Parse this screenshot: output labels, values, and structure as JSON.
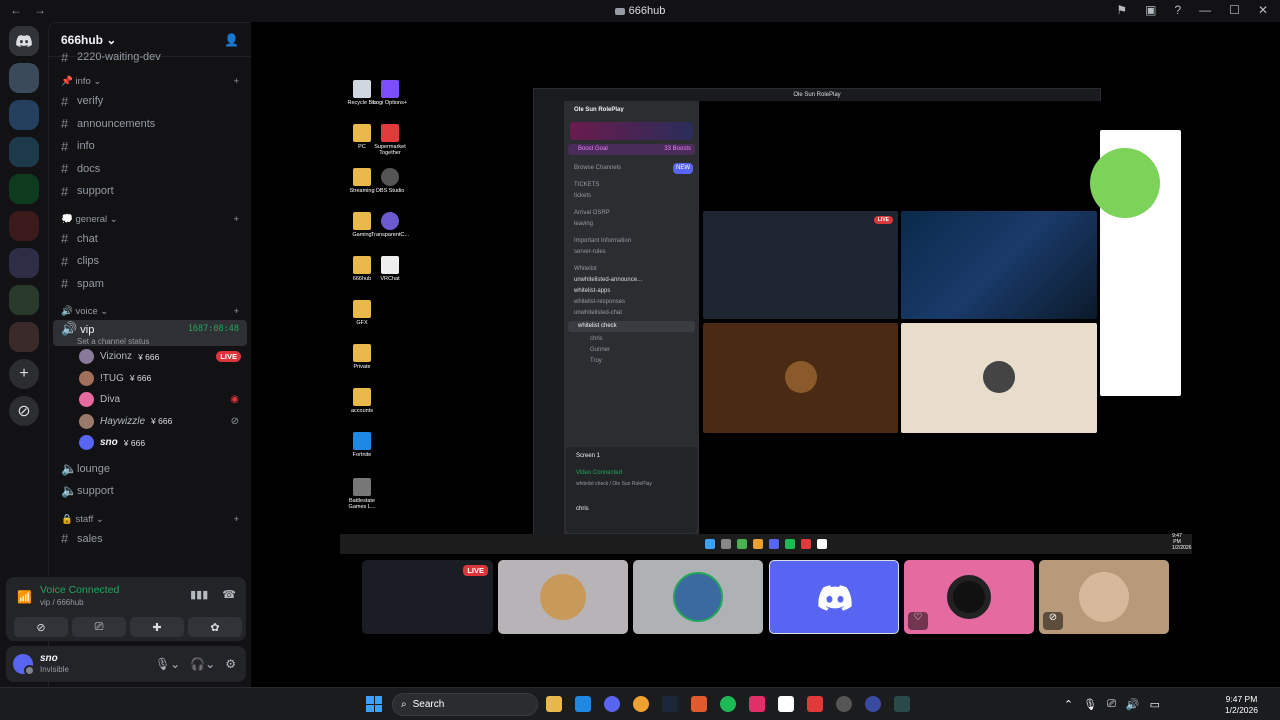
{
  "window": {
    "title": "666hub"
  },
  "server": {
    "name": "666hub"
  },
  "channels": {
    "top_channel": "2220-waiting-dev",
    "cat_info": "info",
    "info_items": [
      "verify",
      "announcements",
      "info",
      "docs",
      "support"
    ],
    "cat_general": "general",
    "general_items": [
      "chat",
      "clips",
      "spam"
    ],
    "cat_voice": "voice",
    "vip": {
      "name": "vip",
      "timer": "1687:08:48",
      "status": "Set a channel status"
    },
    "members": [
      {
        "name": "Vizionz",
        "tag": "666",
        "live": "LIVE"
      },
      {
        "name": "!TUG",
        "tag": "666"
      },
      {
        "name": "Diva"
      },
      {
        "name": "Haywizzle",
        "tag": "666"
      },
      {
        "name": "sno",
        "tag": "666"
      }
    ],
    "voice_items": [
      "lounge",
      "support"
    ],
    "cat_staff": "staff",
    "staff_items": [
      "sales"
    ]
  },
  "voice_panel": {
    "title": "Voice Connected",
    "sub": "vip / 666hub"
  },
  "user": {
    "name": "sno",
    "status": "Invisible"
  },
  "stream": {
    "inner_title": "Ole Sun RolePlay",
    "inner_server": "Ole Sun RolePlay",
    "inner_boost": "Boost Goal",
    "inner_boosts": "33 Boosts",
    "inner_channels": [
      "Browse Channels",
      "TICKETS",
      "tickets",
      "Arrival OSRP",
      "leaving",
      "Important Information",
      "server-rules",
      "Whitelist",
      "unwhitelisted-announce...",
      "whitelist-apps",
      "whitelist-responses",
      "unwhitelisted-chat",
      "whitelist check",
      "chris",
      "Gunner",
      "Troy"
    ],
    "inner_new": "NEW",
    "inner_screen": "Screen 1",
    "inner_vc": "Video Connected",
    "inner_vc_sub": "whitelist check / Ole Sun RolePlay",
    "inner_user": "chris",
    "live": "LIVE",
    "desktop_icons": [
      "Recycle Bin",
      "Logi Options+",
      "PC",
      "Supermarket Together",
      "Streaming",
      "OBS Studio",
      "Gaming",
      "TransparentC...",
      "666hub",
      "VRChat",
      "GFX",
      "Private",
      "accounts",
      "Fortnite",
      "Battlestate Games L..."
    ],
    "clock_time": "9:47 PM",
    "clock_date": "1/2/2026"
  },
  "thumbs": {
    "live": "LIVE"
  },
  "taskbar": {
    "search": "Search",
    "time": "9:47 PM",
    "date": "1/2/2026"
  },
  "colors": {
    "accent": "#5865f2",
    "green": "#23a55a",
    "red": "#da373c"
  }
}
